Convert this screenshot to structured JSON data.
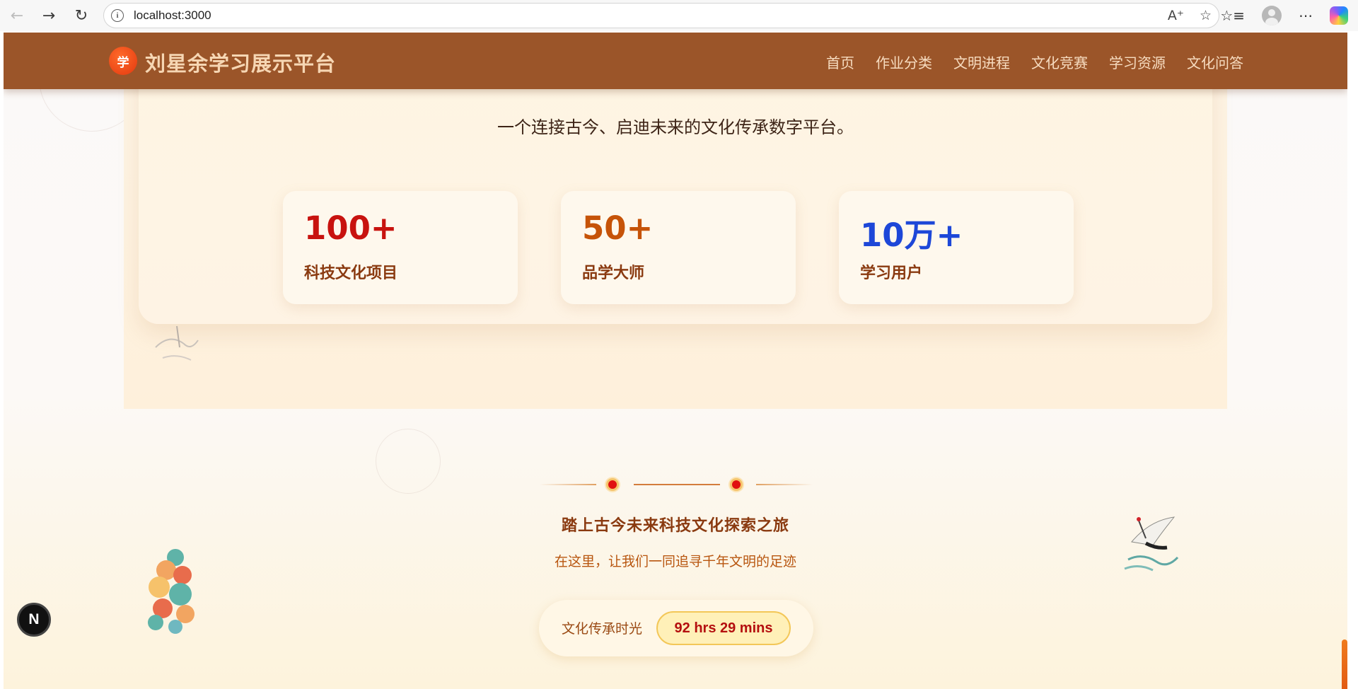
{
  "browser": {
    "url": "localhost:3000",
    "back_icon": "arrow-left-icon",
    "forward_icon": "arrow-right-icon",
    "reload_icon": "reload-icon"
  },
  "header": {
    "logo_char": "学",
    "title": "刘星余学习展示平台",
    "nav": [
      "首页",
      "作业分类",
      "文明进程",
      "文化竞赛",
      "学习资源",
      "文化问答"
    ]
  },
  "hero": {
    "subtitle": "一个连接古今、启迪未来的文化传承数字平台。",
    "stats": [
      {
        "value": "100+",
        "label": "科技文化项目",
        "color": "#c8130f"
      },
      {
        "value": "50+",
        "label": "品学大师",
        "color": "#c65308"
      },
      {
        "value": "10万+",
        "label": "学习用户",
        "color": "#1d47d8"
      }
    ]
  },
  "journey": {
    "title": "踏上古今未来科技文化探索之旅",
    "subtitle": "在这里，让我们一同追寻千年文明的足迹",
    "timer_label": "文化传承时光",
    "timer_value": "92 hrs 29 mins"
  },
  "dev_indicator": {
    "label": "N"
  },
  "colors": {
    "header_bg": "#9b5529",
    "accent_red": "#e01010",
    "accent_orange": "#f07b1d"
  }
}
